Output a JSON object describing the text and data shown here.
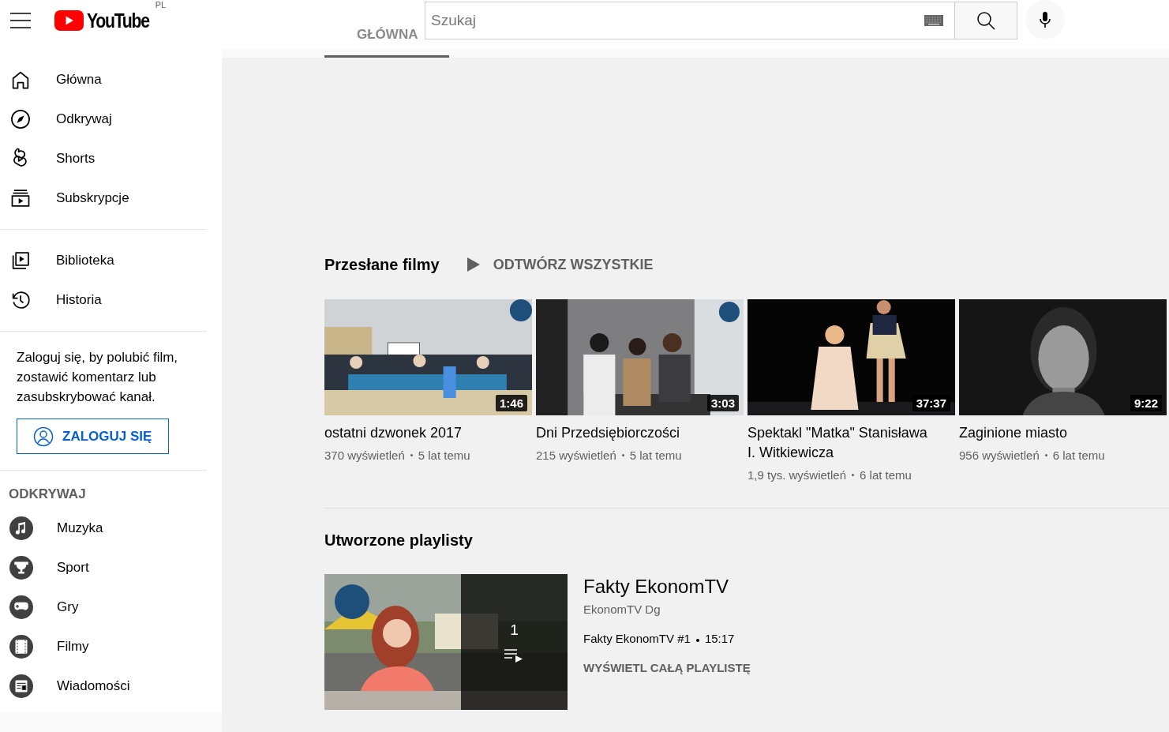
{
  "header": {
    "logo": "YouTube",
    "country": "PL",
    "search": {
      "placeholder": "Szukaj"
    }
  },
  "channel_tabs": [
    {
      "label": "GŁÓWNA",
      "selected": true
    }
  ],
  "sidebar": {
    "main": [
      {
        "label": "Główna"
      },
      {
        "label": "Odkrywaj"
      },
      {
        "label": "Shorts"
      },
      {
        "label": "Subskrypcje"
      }
    ],
    "library": [
      {
        "label": "Biblioteka"
      },
      {
        "label": "Historia"
      }
    ],
    "signin": {
      "text": "Zaloguj się, by polubić film, zostawić komentarz lub zasubskrybować kanał.",
      "button": "ZALOGUJ SIĘ"
    },
    "explore": {
      "heading": "ODKRYWAJ",
      "items": [
        {
          "label": "Muzyka"
        },
        {
          "label": "Sport"
        },
        {
          "label": "Gry"
        },
        {
          "label": "Filmy"
        },
        {
          "label": "Wiadomości"
        }
      ]
    }
  },
  "uploads": {
    "title": "Przesłane filmy",
    "play_all": "ODTWÓRZ WSZYSTKIE",
    "videos": [
      {
        "title": "ostatni dzwonek 2017",
        "duration": "1:46",
        "views": "370 wyświetleń",
        "age": "5 lat temu"
      },
      {
        "title": "Dni Przedsiębiorczości",
        "duration": "3:03",
        "views": "215 wyświetleń",
        "age": "5 lat temu"
      },
      {
        "title": "Spektakl \"Matka\" Stanisława I. Witkiewicza",
        "duration": "37:37",
        "views": "1,9 tys. wyświetleń",
        "age": "6 lat temu"
      },
      {
        "title": "Zaginione miasto",
        "duration": "9:22",
        "views": "956 wyświetleń",
        "age": "6 lat temu"
      }
    ]
  },
  "playlists": {
    "title": "Utworzone playlisty",
    "items": [
      {
        "title": "Fakty EkonomTV",
        "channel": "EkonomTV Dg",
        "count": "1",
        "video": "Fakty EkonomTV #1",
        "duration": "15:17",
        "view_all": "WYŚWIETL CAŁĄ PLAYLISTĘ"
      }
    ]
  }
}
